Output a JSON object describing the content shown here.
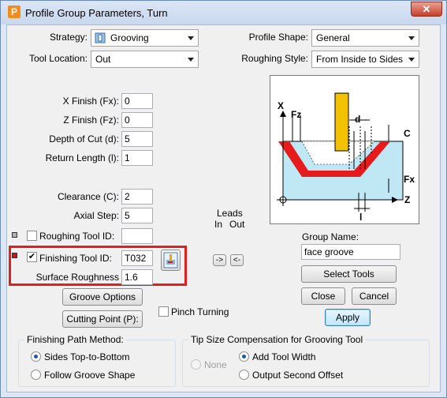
{
  "window": {
    "title": "Profile Group Parameters, Turn",
    "close_glyph": "✕",
    "app_icon_letter": "P"
  },
  "strategy": {
    "label": "Strategy:",
    "value": "Grooving"
  },
  "tool_location": {
    "label": "Tool Location:",
    "value": "Out"
  },
  "profile_shape": {
    "label": "Profile Shape:",
    "value": "General"
  },
  "roughing_style": {
    "label": "Roughing Style:",
    "value": "From Inside to Sides"
  },
  "x_finish": {
    "label": "X Finish (Fx):",
    "value": "0"
  },
  "z_finish": {
    "label": "Z Finish (Fz):",
    "value": "0"
  },
  "depth_of_cut": {
    "label": "Depth of Cut (d):",
    "value": "5"
  },
  "return_length": {
    "label": "Return Length (l):",
    "value": "1"
  },
  "clearance": {
    "label": "Clearance (C):",
    "value": "2"
  },
  "axial_step": {
    "label": "Axial Step:",
    "value": "5"
  },
  "roughing_tool": {
    "label": "Roughing Tool ID:",
    "value": "",
    "checked": false,
    "color": "#b0b0b0"
  },
  "finishing_tool": {
    "label": "Finishing Tool ID:",
    "value": "T032",
    "checked": true,
    "color": "#c01818"
  },
  "surface_roughness": {
    "label": "Surface Roughness",
    "value": "1.6"
  },
  "leads": {
    "title": "Leads",
    "in": "In",
    "out": "Out",
    "in_button": "->",
    "out_button": "<-"
  },
  "buttons": {
    "groove_options": "Groove Options",
    "cutting_point": "Cutting Point (P):",
    "select_tools": "Select Tools",
    "close": "Close",
    "cancel": "Cancel",
    "apply": "Apply"
  },
  "pinch_turning": {
    "label": "Pinch Turning",
    "checked": false
  },
  "group_name": {
    "label": "Group Name:",
    "value": "face groove"
  },
  "finishing_path": {
    "title": "Finishing Path Method:",
    "options": [
      "Sides Top-to-Bottom",
      "Follow Groove Shape"
    ],
    "selected": 0
  },
  "tip_size": {
    "title": "Tip Size Compensation for Grooving Tool",
    "none": "None",
    "options": [
      "Add Tool Width",
      "Output Second Offset"
    ],
    "selected": 0
  },
  "diagram": {
    "x": "X",
    "z": "Z",
    "fz": "Fz",
    "fx": "Fx",
    "d": "d",
    "c": "C",
    "l": "l"
  },
  "colors": {
    "highlight": "#e01f1f",
    "tool": "#f2c200",
    "stock": "#bfe8f4",
    "profile": "#e61b1b"
  }
}
